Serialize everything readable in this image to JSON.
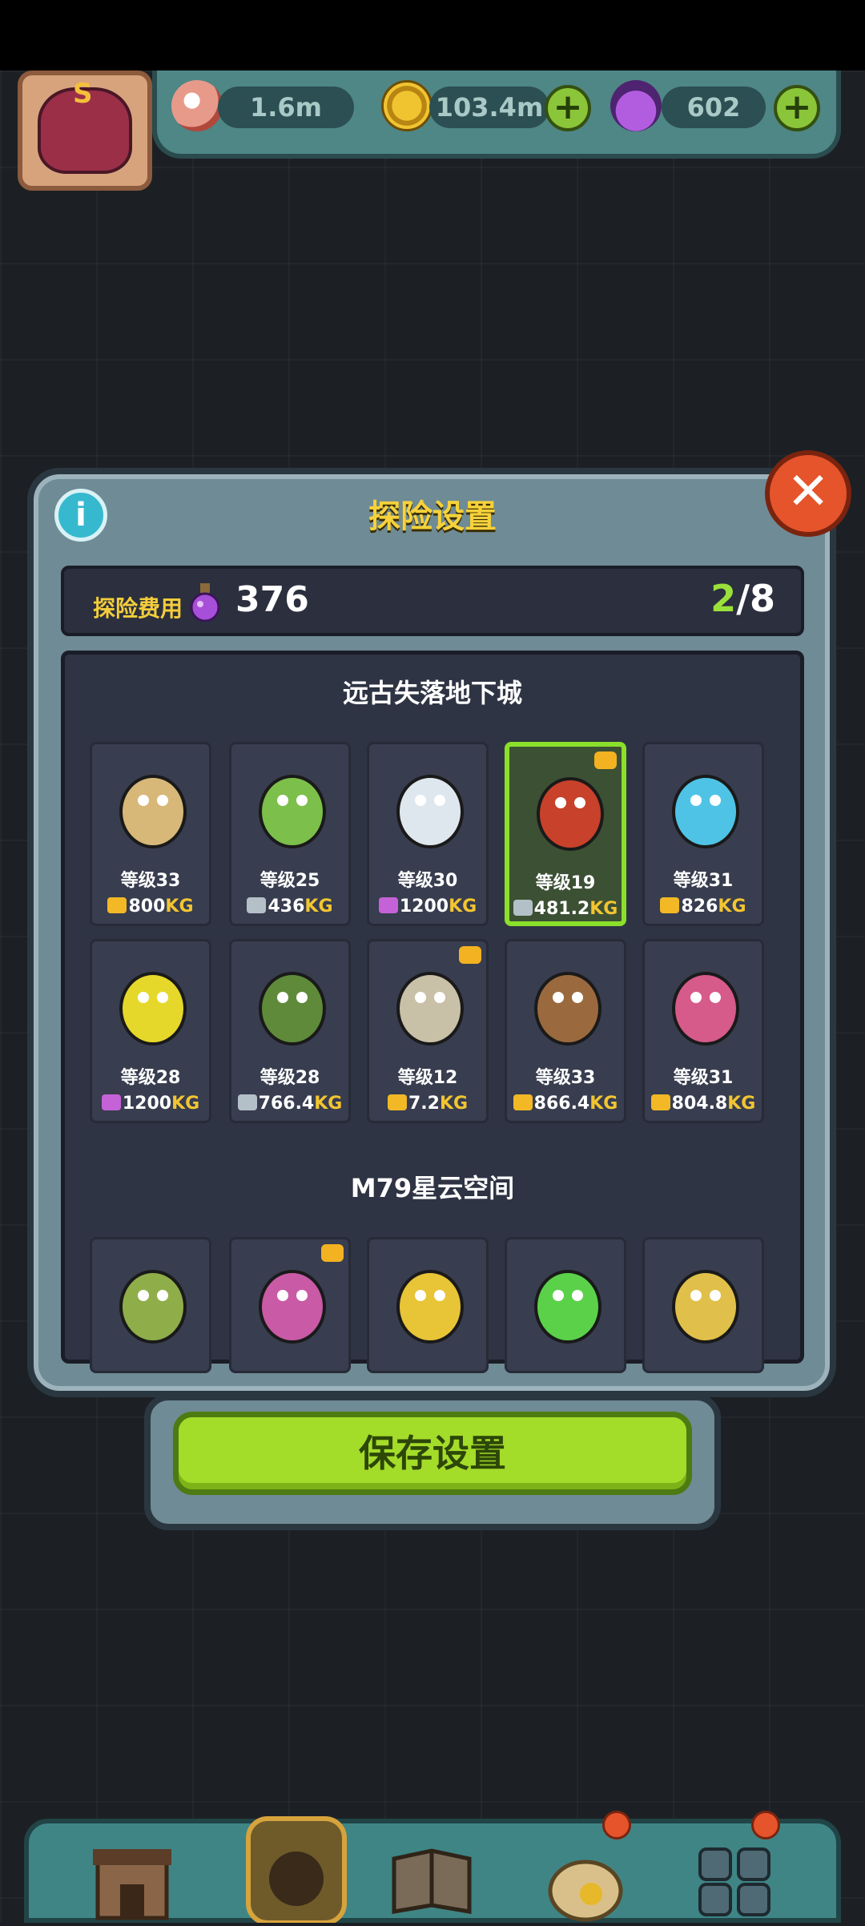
{
  "resources": {
    "eyes": "1.6m",
    "coins": "103.4m",
    "potions": "602"
  },
  "dialog": {
    "title": "探险设置",
    "cost_label": "探险费用",
    "cost_value": "376",
    "slots_current": "2",
    "slots_total": "/8",
    "save_label": "保存设置"
  },
  "sections": [
    {
      "title": "远古失落地下城",
      "monsters": [
        {
          "level": "等级33",
          "weight": "800",
          "unit": "KG",
          "tier": "gold",
          "color": "#d8b878",
          "selected": false,
          "badge": false
        },
        {
          "level": "等级25",
          "weight": "436",
          "unit": "KG",
          "tier": "silver",
          "color": "#7cbf4a",
          "selected": false,
          "badge": false
        },
        {
          "level": "等级30",
          "weight": "1200",
          "unit": "KG",
          "tier": "rainbow",
          "color": "#dfe7ee",
          "selected": false,
          "badge": false
        },
        {
          "level": "等级19",
          "weight": "481.2",
          "unit": "KG",
          "tier": "silver",
          "color": "#c8412a",
          "selected": true,
          "badge": true
        },
        {
          "level": "等级31",
          "weight": "826",
          "unit": "KG",
          "tier": "gold",
          "color": "#4fc3e6",
          "selected": false,
          "badge": false
        },
        {
          "level": "等级28",
          "weight": "1200",
          "unit": "KG",
          "tier": "rainbow",
          "color": "#e6d82a",
          "selected": false,
          "badge": false
        },
        {
          "level": "等级28",
          "weight": "766.4",
          "unit": "KG",
          "tier": "silver",
          "color": "#5f8a3a",
          "selected": false,
          "badge": false
        },
        {
          "level": "等级12",
          "weight": "7.2",
          "unit": "KG",
          "tier": "gold",
          "color": "#c9c0a8",
          "selected": false,
          "badge": true
        },
        {
          "level": "等级33",
          "weight": "866.4",
          "unit": "KG",
          "tier": "gold",
          "color": "#9a6a3e",
          "selected": false,
          "badge": false
        },
        {
          "level": "等级31",
          "weight": "804.8",
          "unit": "KG",
          "tier": "gold",
          "color": "#d65a8a",
          "selected": false,
          "badge": false
        }
      ]
    },
    {
      "title": "M79星云空间",
      "monsters": [
        {
          "color": "#8fae4a",
          "badge": false
        },
        {
          "color": "#c95aa6",
          "badge": true
        },
        {
          "color": "#e8c437",
          "badge": false
        },
        {
          "color": "#5bd14a",
          "badge": false
        },
        {
          "color": "#e0c04a",
          "badge": false
        }
      ]
    }
  ],
  "colors": {
    "accent_green": "#9be03a",
    "title_yellow": "#f6d23a",
    "weight_gold": "#f2c531"
  }
}
